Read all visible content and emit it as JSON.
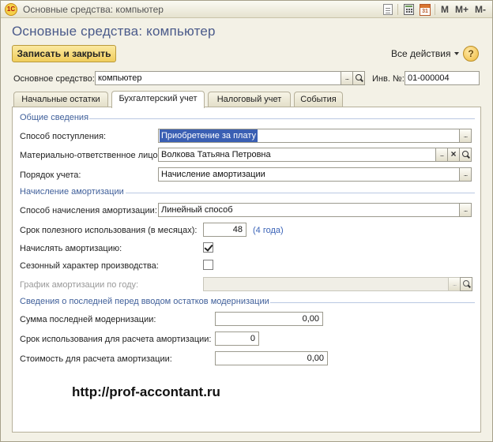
{
  "window": {
    "title": "Основные средства: компьютер",
    "logo_text": "1С",
    "toolbar": {
      "m_label": "M",
      "m_plus_label": "M+",
      "m_minus_label": "M-",
      "calendar_day": "31"
    }
  },
  "form": {
    "title": "Основные средства: компьютер",
    "save_close_label": "Записать и закрыть",
    "all_actions_label": "Все действия",
    "help_label": "?",
    "asset_label": "Основное средство:",
    "asset_value": "компьютер",
    "inv_label": "Инв. №:",
    "inv_value": "01-000004"
  },
  "tabs": [
    {
      "label": "Начальные остатки"
    },
    {
      "label": "Бухгалтерский учет"
    },
    {
      "label": "Налоговый учет"
    },
    {
      "label": "События"
    }
  ],
  "general": {
    "section_title": "Общие сведения",
    "receipt_method_label": "Способ поступления:",
    "receipt_method_value": "Приобретение за плату",
    "responsible_label": "Материально-ответственное лицо:",
    "responsible_value": "Волкова Татьяна Петровна",
    "accounting_order_label": "Порядок учета:",
    "accounting_order_value": "Начисление амортизации"
  },
  "depreciation": {
    "section_title": "Начисление амортизации",
    "method_label": "Способ начисления амортизации:",
    "method_value": "Линейный способ",
    "useful_life_label": "Срок полезного использования (в месяцах):",
    "useful_life_value": "48",
    "useful_life_hint": "(4 года)",
    "charge_label": "Начислять амортизацию:",
    "charge_checked": true,
    "seasonal_label": "Сезонный характер производства:",
    "seasonal_checked": false,
    "schedule_label": "График амортизации по году:",
    "schedule_value": ""
  },
  "modernization": {
    "section_title": "Сведения о последней перед вводом остатков модернизации",
    "sum_label": "Сумма последней модернизации:",
    "sum_value": "0,00",
    "term_label": "Срок использования для расчета амортизации:",
    "term_value": "0",
    "cost_label": "Стоимость для расчета амортизации:",
    "cost_value": "0,00"
  },
  "watermark": "http://prof-accontant.ru"
}
